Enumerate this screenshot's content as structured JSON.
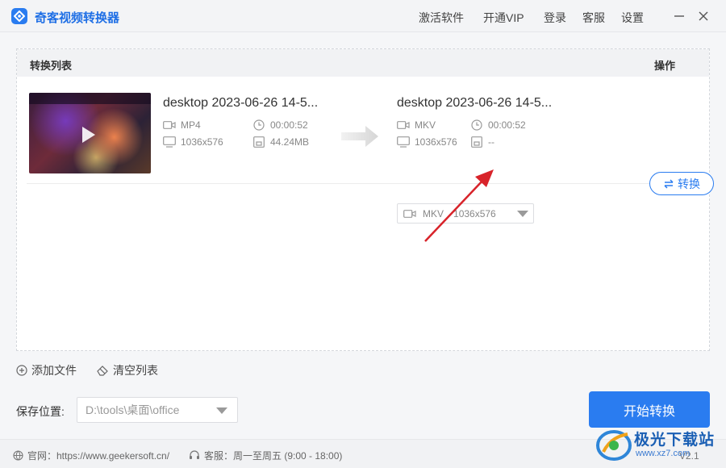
{
  "app": {
    "title": "奇客视频转换器"
  },
  "nav": [
    "激活软件",
    "开通VIP",
    "登录",
    "客服",
    "设置"
  ],
  "list": {
    "header_left": "转换列表",
    "header_right": "操作",
    "items": [
      {
        "source": {
          "name": "desktop 2023-06-26 14-5...",
          "format": "MP4",
          "duration": "00:00:52",
          "resolution": "1036x576",
          "size": "44.24MB"
        },
        "target": {
          "name": "desktop 2023-06-26 14-5...",
          "format": "MKV",
          "duration": "00:00:52",
          "resolution": "1036x576",
          "size": "--"
        },
        "format_select": {
          "format": "MKV",
          "resolution": "1036x576"
        },
        "convert_label": "转换"
      }
    ]
  },
  "actions": {
    "add_file": "添加文件",
    "clear_list": "清空列表"
  },
  "save": {
    "label": "保存位置:",
    "path": "D:\\tools\\桌面\\office"
  },
  "start_label": "开始转换",
  "footer": {
    "website": "官网：https://www.geekersoft.cn/",
    "service": "客服：周一至周五 (9:00 - 18:00)",
    "version": "V2.1"
  },
  "watermark": {
    "text": "极光下载站",
    "url": "www.xz7.com"
  },
  "colors": {
    "accent": "#2a7cf0",
    "annotation_arrow": "#d8232a"
  }
}
